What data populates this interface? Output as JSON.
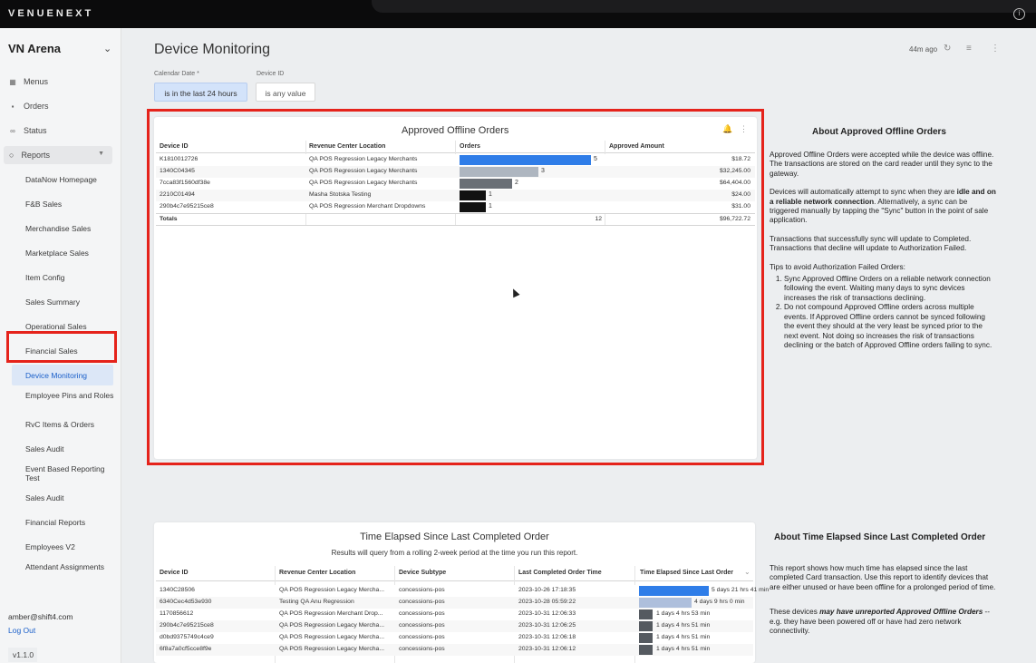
{
  "brand": "VENUENEXT",
  "sidebar": {
    "venue": "VN Arena",
    "top_items": [
      {
        "label": "Menus",
        "icon": "menu-icon"
      },
      {
        "label": "Orders",
        "icon": "orders-icon"
      },
      {
        "label": "Status",
        "icon": "status-icon"
      }
    ],
    "reports_label": "Reports",
    "report_items": [
      "DataNow Homepage",
      "F&B Sales",
      "Merchandise Sales",
      "Marketplace Sales",
      "Item Config",
      "Sales Summary",
      "Operational Sales",
      "Financial Sales",
      "Device Monitoring",
      "Employee Pins and Roles",
      "RvC Items & Orders",
      "Sales Audit",
      "Event Based Reporting Test",
      "Sales Audit",
      "Financial Reports",
      "Employees V2",
      "Attendant Assignments"
    ],
    "active_item": "Device Monitoring",
    "user_email": "amber@shift4.com",
    "logout": "Log Out",
    "version": "v1.1.0"
  },
  "header": {
    "title": "Device Monitoring",
    "last_updated": "44m ago"
  },
  "filters": [
    {
      "label": "Calendar Date *",
      "value": "is in the last 24 hours"
    },
    {
      "label": "Device ID",
      "value": "is any value"
    }
  ],
  "offline_orders": {
    "title": "Approved Offline Orders",
    "columns": [
      "Device ID",
      "Revenue Center Location",
      "Orders",
      "Approved Amount"
    ],
    "rows": [
      {
        "device": "K1810012726",
        "location": "QA POS Regression Legacy Merchants",
        "orders": 5,
        "amount": "$18.72",
        "color": "#2f7de8"
      },
      {
        "device": "1340C04345",
        "location": "QA POS Regression Legacy Merchants",
        "orders": 3,
        "amount": "$32,245.00",
        "color": "#aeb6c0"
      },
      {
        "device": "7cca83f1560df38e",
        "location": "QA POS Regression Legacy Merchants",
        "orders": 2,
        "amount": "$64,404.00",
        "color": "#6a6f76"
      },
      {
        "device": "2210C01494",
        "location": "Masha Stotska Testing",
        "orders": 1,
        "amount": "$24.00",
        "color": "#111111"
      },
      {
        "device": "290b4c7e95215ce8",
        "location": "QA POS Regression Merchant Dropdowns",
        "orders": 1,
        "amount": "$31.00",
        "color": "#111111"
      }
    ],
    "totals_label": "Totals",
    "totals_orders": "12",
    "totals_amount": "$96,722.72"
  },
  "about_offline": {
    "title": "About Approved Offline Orders",
    "p1": "Approved Offline Orders were accepted while the device was offline. The transactions are stored on the card reader until they sync to the gateway.",
    "p2_a": "Devices will automatically attempt to sync when they are ",
    "p2_b": "idle and on a reliable network connection",
    "p2_c": ". Alternatively, a sync can be triggered manually by tapping the \"Sync\" button in the point of sale application.",
    "p3": "Transactions that successfully sync will update to Completed. Transactions that decline will update to Authorization Failed.",
    "tips_title": "Tips to avoid Authorization Failed Orders:",
    "tips": [
      "Sync Approved Offline Orders on a reliable network connection following the event. Waiting many days to sync devices increases the risk of transactions declining.",
      "Do not compound Approved Offline orders across multiple events. If Approved Offline orders cannot be synced following the event they should at the very least be synced prior to the next event. Not doing so increases the risk of transactions declining or the batch of Approved Offline orders failing to sync."
    ]
  },
  "time_elapsed": {
    "title": "Time Elapsed Since Last Completed Order",
    "subtitle": "Results will query from a rolling 2-week period at the time you run this report.",
    "columns": [
      "Device ID",
      "Revenue Center Location",
      "Device Subtype",
      "Last Completed Order Time",
      "Time Elapsed Since Last Order"
    ],
    "rows": [
      {
        "device": "1340C28506",
        "location": "QA POS Regression Legacy Mercha...",
        "subtype": "concessions-pos",
        "time": "2023-10-26 17:18:35",
        "elapsed": "5 days 21 hrs 41 min",
        "fill": 0.62,
        "color": "#2f7de8"
      },
      {
        "device": "6340Cec4d53e930",
        "location": "Testing QA Anu Regression",
        "subtype": "concessions-pos",
        "time": "2023-10-28 05:59:22",
        "elapsed": "4 days 9 hrs 0 min",
        "fill": 0.47,
        "color": "#aebfdc"
      },
      {
        "device": "1170856612",
        "location": "QA POS Regression Merchant Drop...",
        "subtype": "concessions-pos",
        "time": "2023-10-31 12:06:33",
        "elapsed": "1 days 4 hrs 53 min",
        "fill": 0.12,
        "color": "#555a60"
      },
      {
        "device": "290b4c7e95215ce8",
        "location": "QA POS Regression Legacy Mercha...",
        "subtype": "concessions-pos",
        "time": "2023-10-31 12:06:25",
        "elapsed": "1 days 4 hrs 51 min",
        "fill": 0.12,
        "color": "#555a60"
      },
      {
        "device": "d0bd9375749c4ce9",
        "location": "QA POS Regression Legacy Mercha...",
        "subtype": "concessions-pos",
        "time": "2023-10-31 12:06:18",
        "elapsed": "1 days 4 hrs 51 min",
        "fill": 0.12,
        "color": "#555a60"
      },
      {
        "device": "6f8a7a0cf5cce8f9e",
        "location": "QA POS Regression Legacy Mercha...",
        "subtype": "concessions-pos",
        "time": "2023-10-31 12:06:12",
        "elapsed": "1 days 4 hrs 51 min",
        "fill": 0.12,
        "color": "#555a60"
      }
    ]
  },
  "about_time": {
    "title": "About Time Elapsed Since Last Completed Order",
    "p1": "This report shows how much time has elapsed since the last completed Card transaction. Use this report to identify devices that are either unused or have been offline for a prolonged period of time.",
    "p2_a": "These devices ",
    "p2_b": "may have unreported Approved Offline Orders",
    "p2_c": " -- e.g. they have been powered off or have had zero network connectivity."
  }
}
